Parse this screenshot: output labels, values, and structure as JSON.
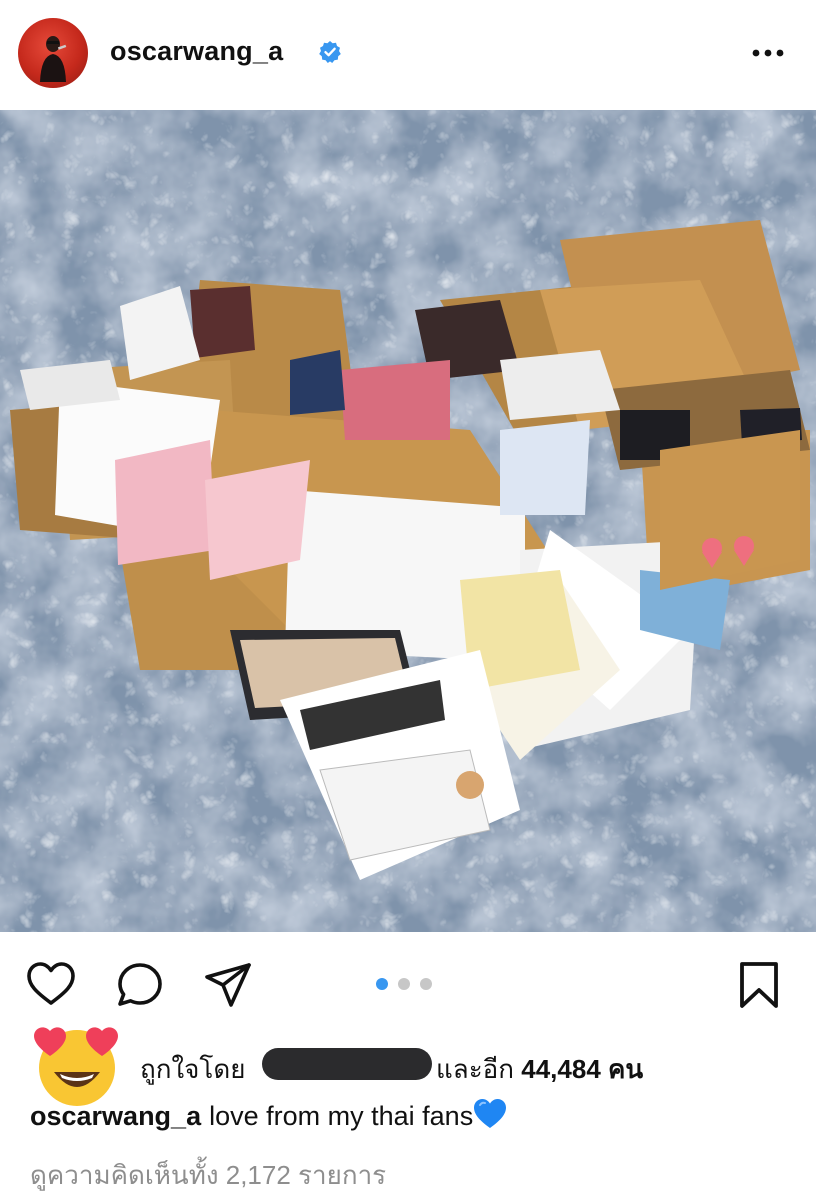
{
  "post": {
    "username": "oscarwang_a",
    "verified_icon": "verified-badge-icon",
    "more_icon": "more-options-icon"
  },
  "carousel": {
    "count": 3,
    "active_index": 0,
    "active_color": "#3897f0",
    "inactive_color": "#c7c7c7"
  },
  "actions": {
    "like_icon": "heart-outline-icon",
    "comment_icon": "comment-bubble-icon",
    "share_icon": "paper-plane-icon",
    "save_icon": "bookmark-icon"
  },
  "likes": {
    "emoji_icon": "heart-eyes-emoji-icon",
    "liked_by_prefix": "ถูกใจโดย",
    "and_others_prefix": "และอีก",
    "count": "44,484",
    "unit": "คน"
  },
  "caption": {
    "username": "oscarwang_a",
    "text": "love from my thai fans",
    "emoji_icon": "blue-heart-icon"
  },
  "comments": {
    "label": "ดูความคิดเห็นทั้ง 2,172 รายการ"
  },
  "colors": {
    "verified": "#3897f0",
    "redaction": "#2b2b2d",
    "secondary_text": "#8e8e8e",
    "blue_heart": "#1f86f3"
  }
}
